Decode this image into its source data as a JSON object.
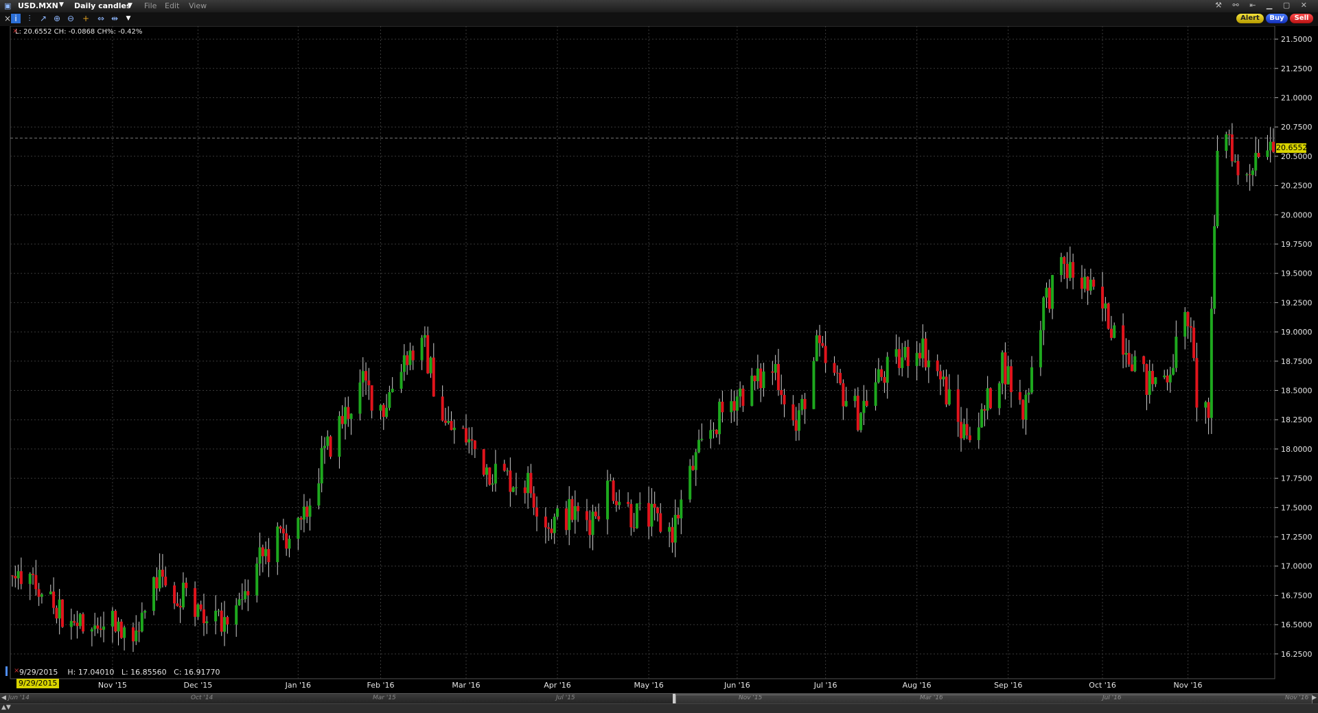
{
  "window": {
    "symbol": "USD.MXN",
    "chart_mode": "Daily candles",
    "menus": [
      "File",
      "Edit",
      "View"
    ]
  },
  "actions": {
    "alert": "Alert",
    "buy": "Buy",
    "sell": "Sell"
  },
  "info_line": "L: 20.6552 CH: -0.0868 CH%: -0.42%",
  "ohlc_readout": "9/29/2015    H: 17.04010   L: 16.85560   C: 16.91770",
  "selected_date": "9/29/2015",
  "last_price_label": "20.6552",
  "navigator_labels": [
    "Jun '14",
    "Oct '14",
    "Mar '15",
    "Jul '15",
    "Nov '15",
    "Mar '16",
    "Jul '16",
    "Nov '16"
  ],
  "colors": {
    "up": "#1ea81e",
    "down": "#e0141c",
    "wick": "#cfcfcf",
    "grid": "#3a3a3a",
    "highlight": "#d9d400",
    "background": "#000000"
  },
  "chart_data": {
    "type": "candlestick",
    "title": "USD.MXN",
    "x_tick_labels": [
      "Nov '15",
      "Dec '15",
      "Jan '16",
      "Feb '16",
      "Mar '16",
      "Apr '16",
      "May '16",
      "Jun '16",
      "Jul '16",
      "Aug '16",
      "Sep '16",
      "Oct '16",
      "Nov '16"
    ],
    "x_tick_dates": [
      "2015-11-02",
      "2015-12-01",
      "2016-01-04",
      "2016-02-01",
      "2016-03-01",
      "2016-04-01",
      "2016-05-02",
      "2016-06-01",
      "2016-07-01",
      "2016-08-01",
      "2016-09-01",
      "2016-10-03",
      "2016-11-01"
    ],
    "x_range": [
      "2015-09-29",
      "2016-11-30"
    ],
    "y_range": [
      16.05,
      21.6
    ],
    "y_ticks": [
      "21.5000",
      "21.2500",
      "21.0000",
      "20.7500",
      "20.5000",
      "20.2500",
      "20.0000",
      "19.7500",
      "19.5000",
      "19.2500",
      "19.0000",
      "18.7500",
      "18.5000",
      "18.2500",
      "18.0000",
      "17.7500",
      "17.5000",
      "17.2500",
      "17.0000",
      "16.7500",
      "16.5000",
      "16.2500"
    ],
    "last_price": 20.6552,
    "grid": true,
    "axis_position": "right",
    "closes": [
      [
        "2015-09-29",
        16.92
      ],
      [
        "2015-10-06",
        16.95
      ],
      [
        "2015-10-13",
        16.65
      ],
      [
        "2015-10-20",
        16.5
      ],
      [
        "2015-10-27",
        16.55
      ],
      [
        "2015-11-03",
        16.55
      ],
      [
        "2015-11-10",
        16.45
      ],
      [
        "2015-11-17",
        16.85
      ],
      [
        "2015-11-24",
        16.78
      ],
      [
        "2015-12-01",
        16.65
      ],
      [
        "2015-12-08",
        16.55
      ],
      [
        "2015-12-15",
        16.6
      ],
      [
        "2015-12-22",
        17.05
      ],
      [
        "2015-12-29",
        17.25
      ],
      [
        "2016-01-05",
        17.3
      ],
      [
        "2016-01-12",
        17.9
      ],
      [
        "2016-01-19",
        18.25
      ],
      [
        "2016-01-26",
        18.55
      ],
      [
        "2016-02-02",
        18.35
      ],
      [
        "2016-02-09",
        18.8
      ],
      [
        "2016-02-16",
        18.85
      ],
      [
        "2016-02-23",
        18.2
      ],
      [
        "2016-03-01",
        18.1
      ],
      [
        "2016-03-08",
        17.85
      ],
      [
        "2016-03-15",
        17.75
      ],
      [
        "2016-03-22",
        17.7
      ],
      [
        "2016-03-29",
        17.35
      ],
      [
        "2016-04-05",
        17.45
      ],
      [
        "2016-04-12",
        17.4
      ],
      [
        "2016-04-19",
        17.7
      ],
      [
        "2016-04-26",
        17.45
      ],
      [
        "2016-05-03",
        17.4
      ],
      [
        "2016-05-10",
        17.3
      ],
      [
        "2016-05-17",
        17.85
      ],
      [
        "2016-05-24",
        18.2
      ],
      [
        "2016-05-31",
        18.45
      ],
      [
        "2016-06-07",
        18.55
      ],
      [
        "2016-06-14",
        18.7
      ],
      [
        "2016-06-21",
        18.15
      ],
      [
        "2016-06-28",
        18.85
      ],
      [
        "2016-07-05",
        18.55
      ],
      [
        "2016-07-12",
        18.3
      ],
      [
        "2016-07-19",
        18.6
      ],
      [
        "2016-07-26",
        18.75
      ],
      [
        "2016-08-02",
        18.9
      ],
      [
        "2016-08-09",
        18.6
      ],
      [
        "2016-08-16",
        18.15
      ],
      [
        "2016-08-23",
        18.25
      ],
      [
        "2016-08-30",
        18.75
      ],
      [
        "2016-09-06",
        18.3
      ],
      [
        "2016-09-13",
        19.25
      ],
      [
        "2016-09-20",
        19.55
      ],
      [
        "2016-09-27",
        19.4
      ],
      [
        "2016-10-04",
        19.15
      ],
      [
        "2016-10-11",
        18.9
      ],
      [
        "2016-10-18",
        18.55
      ],
      [
        "2016-10-25",
        18.65
      ],
      [
        "2016-11-01",
        19.15
      ],
      [
        "2016-11-04",
        18.45
      ],
      [
        "2016-11-08",
        18.3
      ],
      [
        "2016-11-11",
        20.6
      ],
      [
        "2016-11-15",
        20.7
      ],
      [
        "2016-11-18",
        20.3
      ],
      [
        "2016-11-22",
        20.4
      ],
      [
        "2016-11-25",
        20.6
      ],
      [
        "2016-11-30",
        20.66
      ]
    ]
  }
}
